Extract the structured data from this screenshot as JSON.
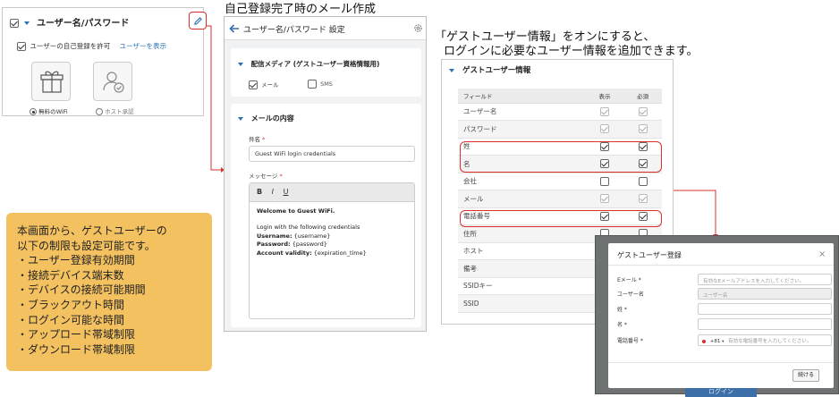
{
  "captions": {
    "top": "自己登録完了時のメール作成",
    "right_line1": "「ゲストユーザー情報」をオンにすると、",
    "right_line2": "ログインに必要なユーザー情報を追加できます。"
  },
  "panel1": {
    "title": "ユーザー名/パスワード",
    "allow_self_register": "ユーザーの自己登録を許可",
    "show_users_link": "ユーザーを表示",
    "options": [
      "無料のWiFi",
      "ホスト承認"
    ]
  },
  "panel2": {
    "header_title": "ユーザー名/パスワード 設定",
    "delivery_section": "配信メディア (ゲストユーザー資格情報用)",
    "delivery_options": [
      "メール",
      "SMS"
    ],
    "mail_section": "メールの内容",
    "subject_label": "件名",
    "subject_value": "Guest WiFi login credentials",
    "message_label": "メッセージ",
    "toolbar": [
      "B",
      "I",
      "U"
    ],
    "message": {
      "greeting": "Welcome to Guest WiFi.",
      "line1": "Login with the following credentials",
      "username_label": "Username:",
      "username_value": " {username}",
      "password_label": "Password:",
      "password_value": " {password}",
      "validity_label": "Account validity:",
      "validity_value": " {expiration_time}"
    }
  },
  "panel3": {
    "title": "ゲストユーザー情報",
    "headers": [
      "フィールド",
      "表示",
      "必須"
    ],
    "rows": [
      {
        "field": "ユーザー名",
        "show": true,
        "req": true,
        "dim": true
      },
      {
        "field": "パスワード",
        "show": true,
        "req": true,
        "dim": true
      },
      {
        "field": "姓",
        "show": true,
        "req": true,
        "dim": false
      },
      {
        "field": "名",
        "show": true,
        "req": true,
        "dim": false
      },
      {
        "field": "会社",
        "show": false,
        "req": false,
        "dim": false
      },
      {
        "field": "メール",
        "show": true,
        "req": true,
        "dim": true
      },
      {
        "field": "電話番号",
        "show": true,
        "req": true,
        "dim": false
      },
      {
        "field": "住所",
        "show": false,
        "req": false,
        "dim": false
      },
      {
        "field": "ホスト",
        "show": false,
        "req": false,
        "dim": false
      },
      {
        "field": "備考",
        "show": false,
        "req": false,
        "dim": false
      },
      {
        "field": "SSIDキー",
        "show": true,
        "req": false,
        "dim": false
      },
      {
        "field": "SSID",
        "show": true,
        "req": false,
        "dim": false
      }
    ]
  },
  "dialog": {
    "title": "ゲストユーザー登録",
    "close": "×",
    "email_label": "Eメール *",
    "email_placeholder": "有効なEメールアドレスを入力してください。",
    "username_label": "ユーザー名",
    "username_placeholder": "ユーザー名",
    "last_label": "姓 *",
    "first_label": "名 *",
    "phone_label": "電話番号 *",
    "phone_code": "+81",
    "phone_placeholder": "有効な電話番号を入力してください。",
    "continue": "続ける",
    "background_button": "ログイン"
  },
  "note": {
    "lines": [
      "本画面から、ゲストユーザーの",
      "以下の制限も設定可能です。",
      "・ユーザー登録有効期間",
      "・接続デバイス端末数",
      "・デバイスの接続可能期間",
      "・ブラックアウト時間",
      "・ログイン可能な時間",
      "・アップロード帯域制限",
      "・ダウンロード帯域制限"
    ]
  },
  "colors": {
    "accent": "#2b6fb5",
    "highlight": "#d9302c",
    "note_bg": "#f4c160"
  }
}
